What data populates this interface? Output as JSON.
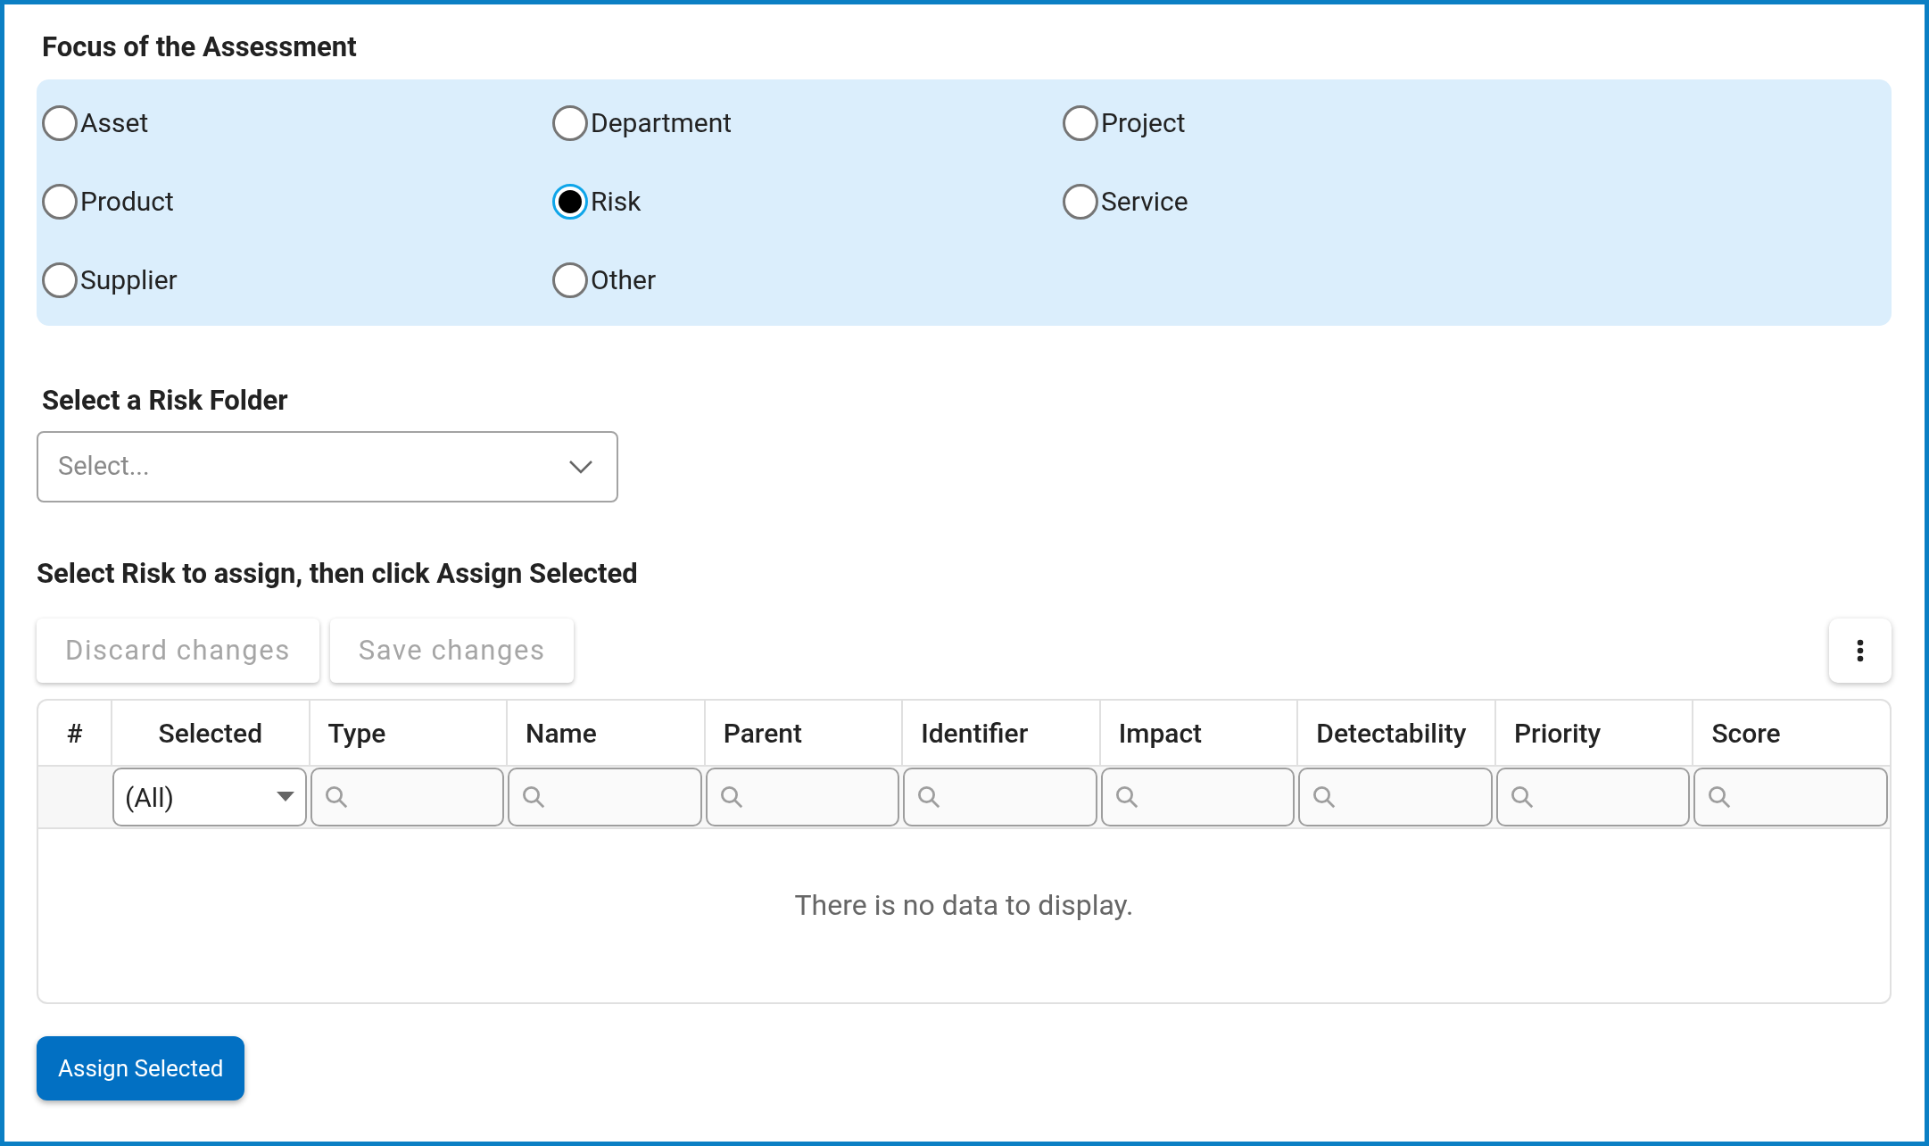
{
  "focus": {
    "title": "Focus of the Assessment",
    "options": [
      {
        "label": "Asset",
        "selected": false
      },
      {
        "label": "Department",
        "selected": false
      },
      {
        "label": "Project",
        "selected": false
      },
      {
        "label": "Product",
        "selected": false
      },
      {
        "label": "Risk",
        "selected": true
      },
      {
        "label": "Service",
        "selected": false
      },
      {
        "label": "Supplier",
        "selected": false
      },
      {
        "label": "Other",
        "selected": false
      }
    ]
  },
  "folder": {
    "title": "Select a Risk Folder",
    "select": {
      "placeholder": "Select..."
    }
  },
  "assign": {
    "title": "Select Risk to assign, then click Assign Selected",
    "toolbar": [
      {
        "label": "Discard changes",
        "disabled": true
      },
      {
        "label": "Save changes",
        "disabled": true
      }
    ],
    "table": {
      "columns": [
        {
          "label": "#",
          "kind": "plain"
        },
        {
          "label": "Selected",
          "kind": "dropdown",
          "value": "(All)"
        },
        {
          "label": "Type",
          "kind": "search"
        },
        {
          "label": "Name",
          "kind": "search"
        },
        {
          "label": "Parent",
          "kind": "search"
        },
        {
          "label": "Identifier",
          "kind": "search"
        },
        {
          "label": "Impact",
          "kind": "search"
        },
        {
          "label": "Detectability",
          "kind": "search"
        },
        {
          "label": "Priority",
          "kind": "search"
        },
        {
          "label": "Score",
          "kind": "search"
        }
      ],
      "empty_message": "There is no data to display."
    },
    "button": "Assign Selected"
  }
}
